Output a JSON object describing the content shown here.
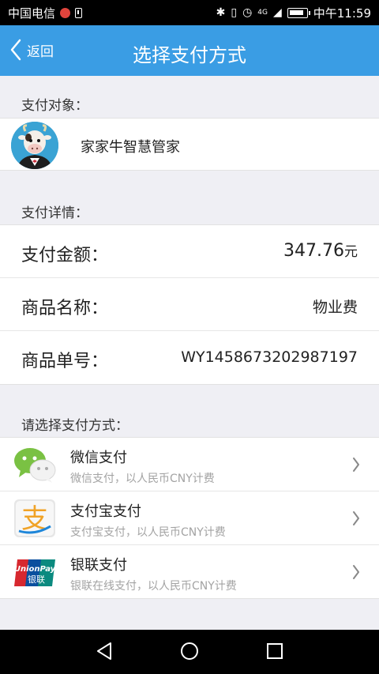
{
  "status": {
    "carrier": "中国电信",
    "time": "中午11:59",
    "network_label": "4G"
  },
  "nav": {
    "back_label": "返回",
    "title": "选择支付方式"
  },
  "merchant": {
    "section_label": "支付对象：",
    "name": "家家牛智慧管家"
  },
  "details": {
    "section_label": "支付详情：",
    "rows": [
      {
        "key": "支付金额：",
        "value": "347.76",
        "unit": "元"
      },
      {
        "key": "商品名称：",
        "value": "物业费"
      },
      {
        "key": "商品单号：",
        "value": "WY1458673202987197"
      }
    ]
  },
  "payment": {
    "section_label": "请选择支付方式：",
    "methods": [
      {
        "title": "微信支付",
        "subtitle": "微信支付，以人民币CNY计费",
        "icon": "wechat-icon"
      },
      {
        "title": "支付宝支付",
        "subtitle": "支付宝支付，以人民币CNY计费",
        "icon": "alipay-icon"
      },
      {
        "title": "银联支付",
        "subtitle": "银联在线支付，以人民币CNY计费",
        "icon": "unionpay-icon"
      }
    ]
  },
  "logos": {
    "alipay_glyph": "支",
    "unionpay_text_top": "UnionPay",
    "unionpay_text_bottom": "银联"
  },
  "colors": {
    "nav_bar": "#3a9de4",
    "amount": "#c9303b",
    "background": "#efeff4"
  }
}
